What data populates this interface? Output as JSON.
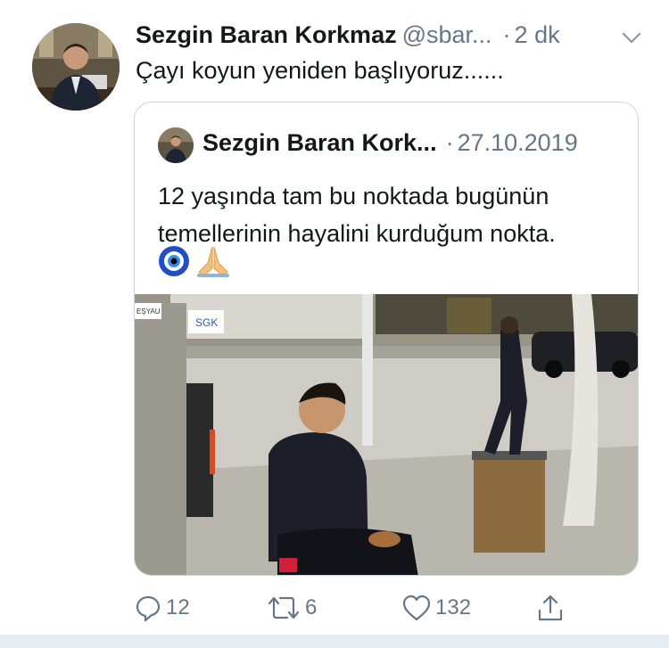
{
  "tweet": {
    "author_name": "Sezgin Baran Korkmaz",
    "handle": "@sbar...",
    "separator": "·",
    "time": "2 dk",
    "text": "Çayı koyun yeniden başlıyoruz......"
  },
  "quoted": {
    "author_name": "Sezgin Baran Kork...",
    "separator": "·",
    "date": "27.10.2019",
    "text_line1": "12 yaşında tam bu noktada bugünün",
    "text_line2": "temellerinin hayalini kurduğum nokta.",
    "photo_signs": {
      "sgk": "SGK",
      "shop": "EŞYAU"
    }
  },
  "actions": {
    "reply_count": "12",
    "retweet_count": "6",
    "like_count": "132"
  },
  "colors": {
    "text": "#14171a",
    "secondary": "#657786",
    "border": "#ccd6dd",
    "footer": "#e6ecf0"
  },
  "icons": [
    "chevron-down-icon",
    "reply-icon",
    "retweet-icon",
    "like-icon",
    "share-icon",
    "evil-eye-emoji",
    "praying-hands-emoji"
  ]
}
